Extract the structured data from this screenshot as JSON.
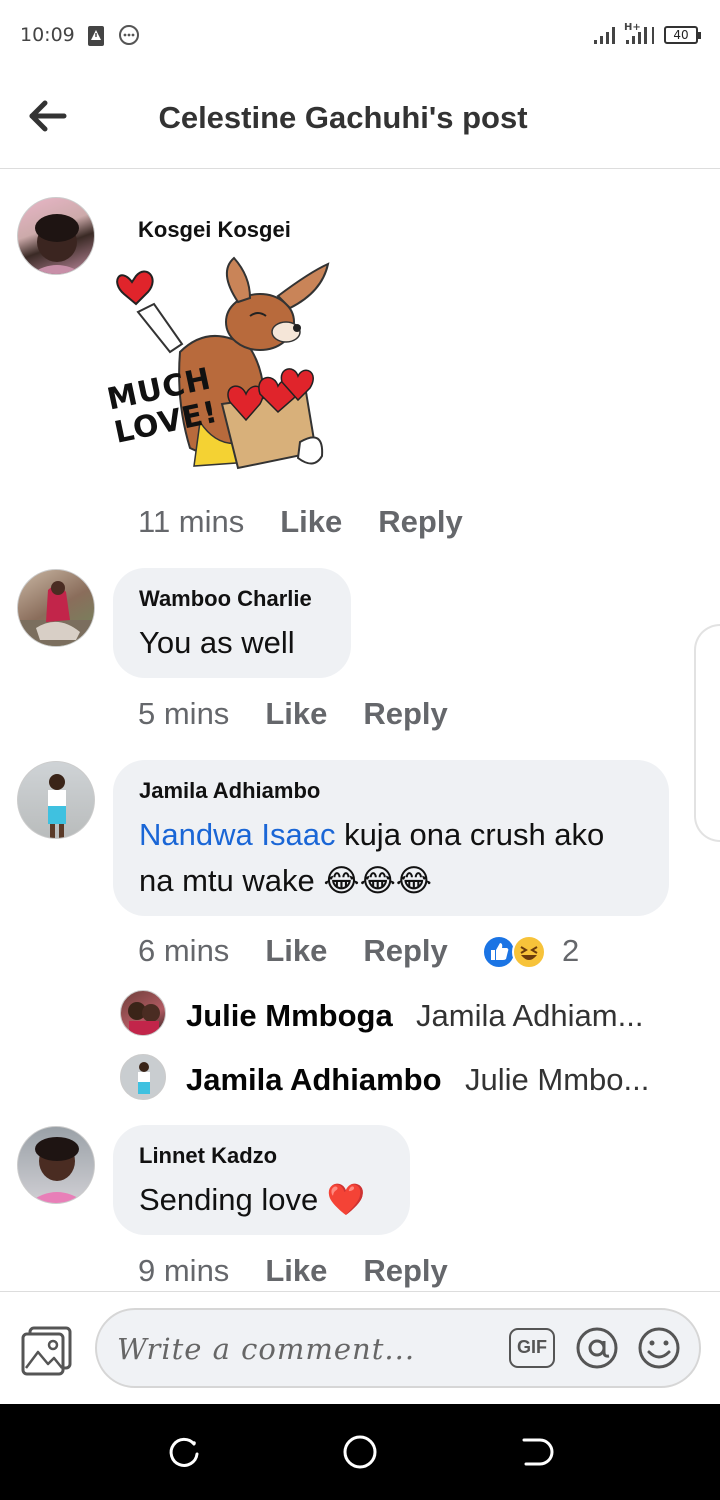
{
  "status_bar": {
    "time": "10:09",
    "battery": "40",
    "icons": [
      "alert-icon",
      "messenger-icon",
      "signal-icon",
      "hplus-signal-icon",
      "battery-icon"
    ]
  },
  "header": {
    "title": "Celestine Gachuhi's post",
    "back_icon": "arrow-left-icon"
  },
  "comments": [
    {
      "author": "Kosgei Kosgei",
      "sticker_text": "MUCH LOVE!",
      "time": "11 mins",
      "like": "Like",
      "reply": "Reply"
    },
    {
      "author": "Wamboo Charlie",
      "text": "You as well",
      "time": "5 mins",
      "like": "Like",
      "reply": "Reply"
    },
    {
      "author": "Jamila Adhiambo",
      "mention": "Nandwa Isaac",
      "text_rest": " kuja ona crush ako",
      "text_line2": "na mtu wake 😂😂😂",
      "time": "6 mins",
      "like": "Like",
      "reply": "Reply",
      "reaction_count": "2",
      "reactions": [
        "like-reaction-icon",
        "haha-reaction-icon"
      ],
      "replies": [
        {
          "author": "Julie Mmboga",
          "preview": "Jamila Adhiam..."
        },
        {
          "author": "Jamila Adhiambo",
          "preview": "Julie Mmbo..."
        }
      ]
    },
    {
      "author": "Linnet Kadzo",
      "text": "Sending love ❤️",
      "time": "9 mins",
      "like": "Like",
      "reply": "Reply"
    }
  ],
  "composer": {
    "placeholder": "Write a comment...",
    "gif_label": "GIF",
    "icons": [
      "photo-icon",
      "gif-icon",
      "at-mention-icon",
      "emoji-icon"
    ]
  },
  "nav_bar": {
    "icons": [
      "recents-icon",
      "home-icon",
      "back-icon"
    ]
  },
  "colors": {
    "mention": "#1a66d6",
    "bubble": "#eff1f4",
    "meta_text": "#65676b",
    "heart": "#e0242b"
  }
}
